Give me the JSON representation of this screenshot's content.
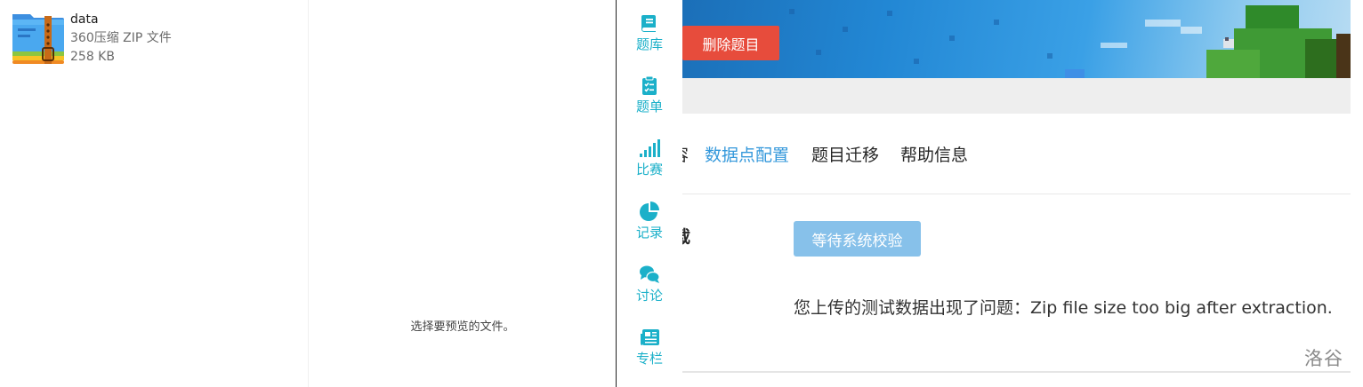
{
  "explorer": {
    "file": {
      "name": "data",
      "type": "360压缩 ZIP 文件",
      "size": "258 KB",
      "icon": "zip-archive-icon"
    },
    "preview_message": "选择要预览的文件。"
  },
  "nav": {
    "accent": "#1bb0c9",
    "items": [
      {
        "label": "题库",
        "icon": "book-icon"
      },
      {
        "label": "题单",
        "icon": "clipboard-list-icon"
      },
      {
        "label": "比赛",
        "icon": "signal-bars-icon"
      },
      {
        "label": "记录",
        "icon": "pie-chart-icon"
      },
      {
        "label": "讨论",
        "icon": "chat-bubbles-icon"
      },
      {
        "label": "专栏",
        "icon": "newspaper-icon"
      }
    ]
  },
  "page": {
    "delete_button": "删除题目",
    "tabs": [
      {
        "label": "容",
        "active": false
      },
      {
        "label": "数据点配置",
        "active": true
      },
      {
        "label": "题目迁移",
        "active": false
      },
      {
        "label": "帮助信息",
        "active": false
      }
    ],
    "section_label": "载",
    "status_button": "等待系统校验",
    "error_message": "您上传的测试数据出现了问题：Zip file size too big after extraction.",
    "watermark": "洛谷",
    "colors": {
      "danger": "#e74c3c",
      "link": "#3498db",
      "pending": "#87c1ea"
    }
  }
}
